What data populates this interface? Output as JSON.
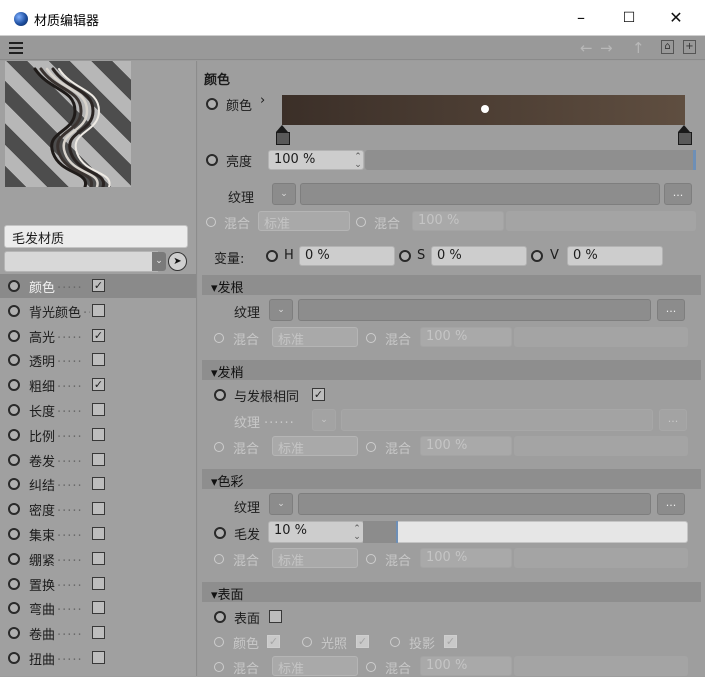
{
  "window": {
    "title": "材质编辑器",
    "min_label": "–",
    "max_label": "☐",
    "close_label": "✕"
  },
  "toolbar": {
    "back": "←",
    "forward": "→",
    "up": "↑",
    "lock": "🔒",
    "new": "+"
  },
  "material": {
    "name": "毛发材质"
  },
  "channels": [
    {
      "label": "颜色",
      "checked": true,
      "active": true
    },
    {
      "label": "背光颜色",
      "checked": false,
      "active": false
    },
    {
      "label": "高光",
      "checked": true,
      "active": false
    },
    {
      "label": "透明",
      "checked": false,
      "active": false
    },
    {
      "label": "粗细",
      "checked": true,
      "active": false
    },
    {
      "label": "长度",
      "checked": false,
      "active": false
    },
    {
      "label": "比例",
      "checked": false,
      "active": false
    },
    {
      "label": "卷发",
      "checked": false,
      "active": false
    },
    {
      "label": "纠结",
      "checked": false,
      "active": false
    },
    {
      "label": "密度",
      "checked": false,
      "active": false
    },
    {
      "label": "集束",
      "checked": false,
      "active": false
    },
    {
      "label": "绷紧",
      "checked": false,
      "active": false
    },
    {
      "label": "置换",
      "checked": false,
      "active": false
    },
    {
      "label": "弯曲",
      "checked": false,
      "active": false
    },
    {
      "label": "卷曲",
      "checked": false,
      "active": false
    },
    {
      "label": "扭曲",
      "checked": false,
      "active": false
    }
  ],
  "color_section": {
    "heading": "颜色",
    "color_label": "颜色",
    "color_arrow": "›",
    "brightness_label": "亮度",
    "brightness_value": "100 %",
    "texture_label": "纹理",
    "mix_label": "混合",
    "mix_mode": "标准",
    "mix_strength_label": "混合",
    "mix_strength": "100 %",
    "variation_label": "变量:",
    "h_label": "H",
    "h_value": "0 %",
    "s_label": "S",
    "s_value": "0 %",
    "v_label": "V",
    "v_value": "0 %"
  },
  "root_section": {
    "title": "发根",
    "texture_label": "纹理",
    "mix_label": "混合",
    "mix_mode": "标准",
    "mix_strength_label": "混合",
    "mix_strength": "100 %"
  },
  "tip_section": {
    "title": "发梢",
    "same_label": "与发根相同",
    "same_checked": true,
    "texture_label": "纹理",
    "texture_dots": "......",
    "mix_label": "混合",
    "mix_mode": "标准",
    "mix_strength_label": "混合",
    "mix_strength": "100 %"
  },
  "tint_section": {
    "title": "色彩",
    "texture_label": "纹理",
    "hair_label": "毛发",
    "hair_value": "10 %",
    "mix_label": "混合",
    "mix_mode": "标准",
    "mix_strength_label": "混合",
    "mix_strength": "100 %"
  },
  "surface_section": {
    "title": "表面",
    "surface_label": "表面",
    "color_label": "颜色",
    "light_label": "光照",
    "shadow_label": "投影",
    "mix_label": "混合",
    "mix_mode": "标准",
    "mix_strength_label": "混合",
    "mix_strength": "100 %"
  },
  "common": {
    "dots_button": "...",
    "dd_arrow": "⌄",
    "spin": "⌃⌄",
    "triangle": "▾",
    "channel_dots": ".....",
    "check": "✓"
  }
}
